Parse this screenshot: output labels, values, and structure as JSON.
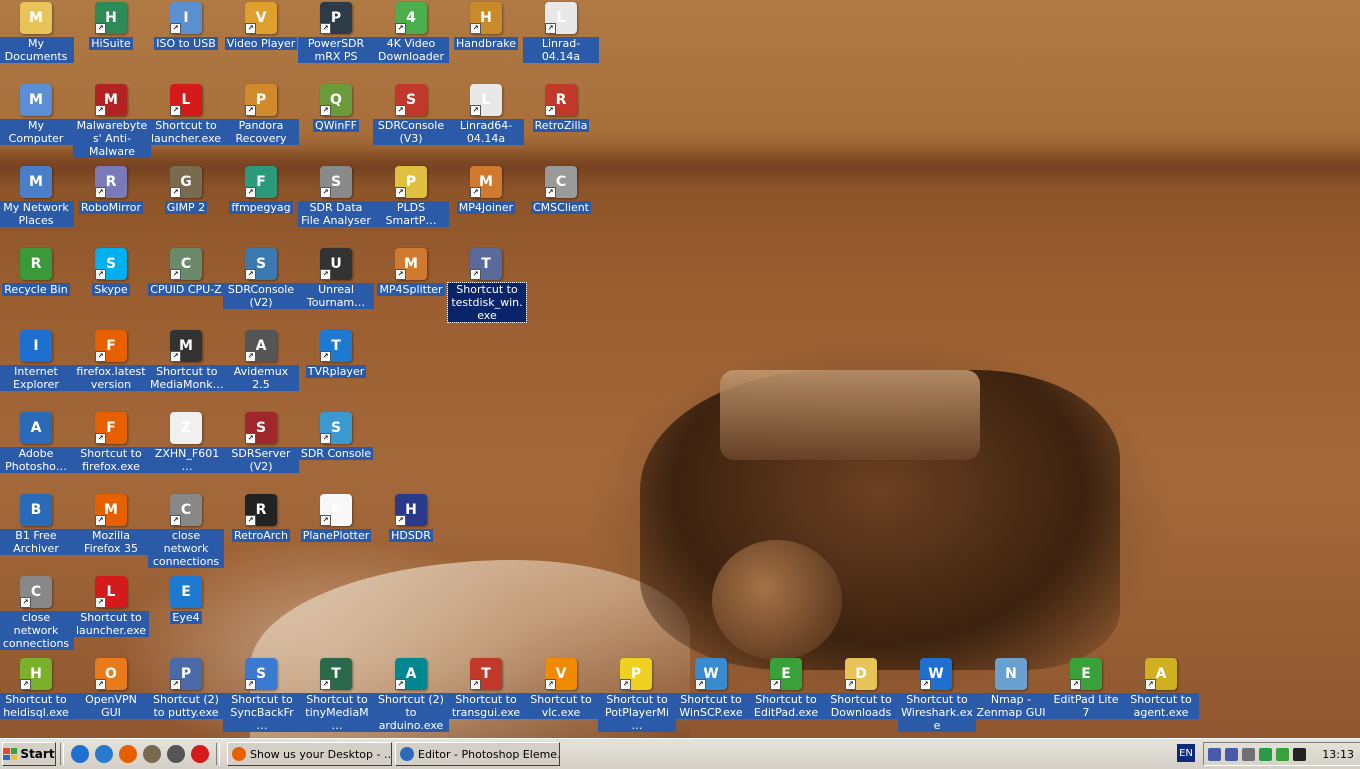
{
  "desktop": {
    "icons": [
      {
        "label": "My Documents",
        "icon": "folder-documents-icon",
        "color": "#e8c35a",
        "shortcut": false
      },
      {
        "label": "HiSuite",
        "icon": "hisuite-icon",
        "color": "#2e8b57",
        "shortcut": true
      },
      {
        "label": "ISO to USB",
        "icon": "usb-drive-icon",
        "color": "#5a8fd0",
        "shortcut": true
      },
      {
        "label": "Video Player",
        "icon": "video-player-icon",
        "color": "#e0a030",
        "shortcut": true
      },
      {
        "label": "PowerSDR mRX PS",
        "icon": "powersdr-icon",
        "color": "#2d3b48",
        "shortcut": true
      },
      {
        "label": "4K Video Downloader",
        "icon": "download-icon",
        "color": "#4cae4c",
        "shortcut": true
      },
      {
        "label": "Handbrake",
        "icon": "handbrake-icon",
        "color": "#c88a2a",
        "shortcut": true
      },
      {
        "label": "Linrad-04.14a",
        "icon": "linux-penguin-icon",
        "color": "#e8e8e8",
        "shortcut": true
      },
      {
        "label": "My Computer",
        "icon": "computer-icon",
        "color": "#5c8ed6",
        "shortcut": false
      },
      {
        "label": "Malwarebytes' Anti-Malware",
        "icon": "malwarebytes-icon",
        "color": "#b22222",
        "shortcut": true
      },
      {
        "label": "Shortcut to launcher.exe",
        "icon": "opera-icon",
        "color": "#d41a1a",
        "shortcut": true
      },
      {
        "label": "Pandora Recovery",
        "icon": "recovery-icon",
        "color": "#d08a2a",
        "shortcut": true
      },
      {
        "label": "QWinFF",
        "icon": "qwinff-icon",
        "color": "#6a9a3a",
        "shortcut": true
      },
      {
        "label": "SDRConsole (V3)",
        "icon": "antenna-icon",
        "color": "#c0392b",
        "shortcut": true
      },
      {
        "label": "Linrad64-04.14a",
        "icon": "linux-penguin-icon",
        "color": "#e8e8e8",
        "shortcut": true
      },
      {
        "label": "RetroZilla",
        "icon": "retrozilla-icon",
        "color": "#c0392b",
        "shortcut": true
      },
      {
        "label": "My Network Places",
        "icon": "network-icon",
        "color": "#4a7fc8",
        "shortcut": false
      },
      {
        "label": "RoboMirror",
        "icon": "robomirror-icon",
        "color": "#7a7ab8",
        "shortcut": true
      },
      {
        "label": "GIMP 2",
        "icon": "gimp-icon",
        "color": "#7a6a50",
        "shortcut": true
      },
      {
        "label": "ffmpegyag",
        "icon": "ffmpeg-icon",
        "color": "#2a9a7a",
        "shortcut": true
      },
      {
        "label": "SDR Data File Analyser",
        "icon": "database-icon",
        "color": "#8a8a8a",
        "shortcut": true
      },
      {
        "label": "PLDS SmartP…",
        "icon": "plds-icon",
        "color": "#e0c040",
        "shortcut": true
      },
      {
        "label": "MP4Joiner",
        "icon": "mp4joiner-icon",
        "color": "#d07a30",
        "shortcut": true
      },
      {
        "label": "CMSClient",
        "icon": "speaker-icon",
        "color": "#9a9a9a",
        "shortcut": true
      },
      {
        "label": "Recycle Bin",
        "icon": "recycle-bin-icon",
        "color": "#3a9a3a",
        "shortcut": false
      },
      {
        "label": "Skype",
        "icon": "skype-icon",
        "color": "#00aff0",
        "shortcut": true
      },
      {
        "label": "CPUID CPU-Z",
        "icon": "chip-icon",
        "color": "#6a8a6a",
        "shortcut": true
      },
      {
        "label": "SDRConsole (V2)",
        "icon": "antenna-icon",
        "color": "#3a7ab0",
        "shortcut": true
      },
      {
        "label": "Unreal Tournam…",
        "icon": "unreal-icon",
        "color": "#333333",
        "shortcut": true
      },
      {
        "label": "MP4Splitter",
        "icon": "mp4splitter-icon",
        "color": "#d07a30",
        "shortcut": true
      },
      {
        "label": "Shortcut to testdisk_win.exe",
        "icon": "disk-icon",
        "color": "#5a6a9a",
        "shortcut": true,
        "selected": true
      },
      {
        "label": "Internet Explorer",
        "icon": "internet-explorer-icon",
        "color": "#1e6fd0",
        "shortcut": false
      },
      {
        "label": "firefox.latest version",
        "icon": "firefox-icon",
        "color": "#e66000",
        "shortcut": true
      },
      {
        "label": "Shortcut to MediaMonk…",
        "icon": "mediamonkey-icon",
        "color": "#333333",
        "shortcut": true
      },
      {
        "label": "Avidemux 2.5",
        "icon": "film-icon",
        "color": "#555555",
        "shortcut": true
      },
      {
        "label": "TVRplayer",
        "icon": "tv-icon",
        "color": "#1e7ad0",
        "shortcut": true
      },
      {
        "label": "Adobe Photosho…",
        "icon": "camera-icon",
        "color": "#2a6ab8",
        "shortcut": false
      },
      {
        "label": "Shortcut to firefox.exe",
        "icon": "firefox-icon",
        "color": "#e66000",
        "shortcut": true
      },
      {
        "label": "ZXHN_F601…",
        "icon": "pdf-icon",
        "color": "#f0f0f0",
        "shortcut": false
      },
      {
        "label": "SDRServer (V2)",
        "icon": "server-icon",
        "color": "#a0282a",
        "shortcut": true
      },
      {
        "label": "SDR Console",
        "icon": "antenna-icon",
        "color": "#3a9ad0",
        "shortcut": true
      },
      {
        "label": "B1 Free Archiver",
        "icon": "archiver-icon",
        "color": "#2a6ab8",
        "shortcut": false
      },
      {
        "label": "Mozilla Firefox 35",
        "icon": "firefox-icon",
        "color": "#e66000",
        "shortcut": true
      },
      {
        "label": "close network connections",
        "icon": "network-close-icon",
        "color": "#888888",
        "shortcut": true
      },
      {
        "label": "RetroArch",
        "icon": "retroarch-icon",
        "color": "#222222",
        "shortcut": true
      },
      {
        "label": "PlanePlotter",
        "icon": "airplane-icon",
        "color": "#f8f8f8",
        "shortcut": true
      },
      {
        "label": "HDSDR",
        "icon": "hdsdr-icon",
        "color": "#2a3a8a",
        "shortcut": true
      },
      {
        "label": "close network connections",
        "icon": "network-close-icon",
        "color": "#888888",
        "shortcut": true
      },
      {
        "label": "Shortcut to launcher.exe",
        "icon": "opera-icon",
        "color": "#d41a1a",
        "shortcut": true
      },
      {
        "label": "Eye4",
        "icon": "eye4-icon",
        "color": "#1e7ad0",
        "shortcut": false
      },
      {
        "label": "Shortcut to heidisql.exe",
        "icon": "heidisql-icon",
        "color": "#7ab02a",
        "shortcut": true
      },
      {
        "label": "OpenVPN GUI",
        "icon": "openvpn-icon",
        "color": "#e87a1a",
        "shortcut": true
      },
      {
        "label": "Shortcut (2) to putty.exe",
        "icon": "putty-icon",
        "color": "#4a6aa8",
        "shortcut": true
      },
      {
        "label": "Shortcut to SyncBackFr…",
        "icon": "syncback-icon",
        "color": "#3a7ad0",
        "shortcut": true
      },
      {
        "label": "Shortcut to tinyMediaM…",
        "icon": "film-icon",
        "color": "#2a6a4a",
        "shortcut": true
      },
      {
        "label": "Shortcut (2) to arduino.exe",
        "icon": "arduino-icon",
        "color": "#00878f",
        "shortcut": true
      },
      {
        "label": "Shortcut to transgui.exe",
        "icon": "transmission-icon",
        "color": "#c0392b",
        "shortcut": true
      },
      {
        "label": "Shortcut to vlc.exe",
        "icon": "vlc-cone-icon",
        "color": "#f08a00",
        "shortcut": true
      },
      {
        "label": "Shortcut to PotPlayerMi…",
        "icon": "potplayer-icon",
        "color": "#f0d020",
        "shortcut": true
      },
      {
        "label": "Shortcut to WinSCP.exe",
        "icon": "winscp-icon",
        "color": "#3a8ad0",
        "shortcut": true
      },
      {
        "label": "Shortcut to EditPad.exe",
        "icon": "editpad-icon",
        "color": "#3aa03a",
        "shortcut": true
      },
      {
        "label": "Shortcut to Downloads",
        "icon": "folder-icon",
        "color": "#e8c35a",
        "shortcut": true
      },
      {
        "label": "Shortcut to Wireshark.exe",
        "icon": "wireshark-icon",
        "color": "#1e6fd0",
        "shortcut": true
      },
      {
        "label": "Nmap - Zenmap GUI",
        "icon": "zenmap-eye-icon",
        "color": "#6aa0d0",
        "shortcut": false
      },
      {
        "label": "EditPad Lite 7",
        "icon": "editpad-icon",
        "color": "#3aa03a",
        "shortcut": true
      },
      {
        "label": "Shortcut to agent.exe",
        "icon": "agent-icon",
        "color": "#d0b020",
        "shortcut": true
      }
    ]
  },
  "taskbar": {
    "start_label": "Start",
    "quicklaunch": [
      {
        "icon": "internet-explorer-icon",
        "color": "#1e6fd0"
      },
      {
        "icon": "outlook-icon",
        "color": "#2a7ad0"
      },
      {
        "icon": "firefox-icon",
        "color": "#e66000"
      },
      {
        "icon": "gimp-icon",
        "color": "#7a6a50"
      },
      {
        "icon": "avidemux-icon",
        "color": "#555555"
      },
      {
        "icon": "opera-icon",
        "color": "#d41a1a"
      }
    ],
    "tasks": [
      {
        "label": "Show us your Desktop - …",
        "icon": "firefox-icon",
        "color": "#e66000"
      },
      {
        "label": "Editor - Photoshop Eleme…",
        "icon": "photoshop-icon",
        "color": "#2a6ab8"
      }
    ],
    "language": "EN",
    "tray_icons": [
      {
        "icon": "network-disconnected-icon",
        "color": "#4a5aa8"
      },
      {
        "icon": "network-disconnected-icon",
        "color": "#4a5aa8"
      },
      {
        "icon": "audio-icon",
        "color": "#707070"
      },
      {
        "icon": "sdr-icon",
        "color": "#2a9a4a"
      },
      {
        "icon": "heidisql-tray-icon",
        "color": "#3aa03a"
      },
      {
        "icon": "spy-icon",
        "color": "#222222"
      }
    ],
    "clock": "13:13"
  }
}
